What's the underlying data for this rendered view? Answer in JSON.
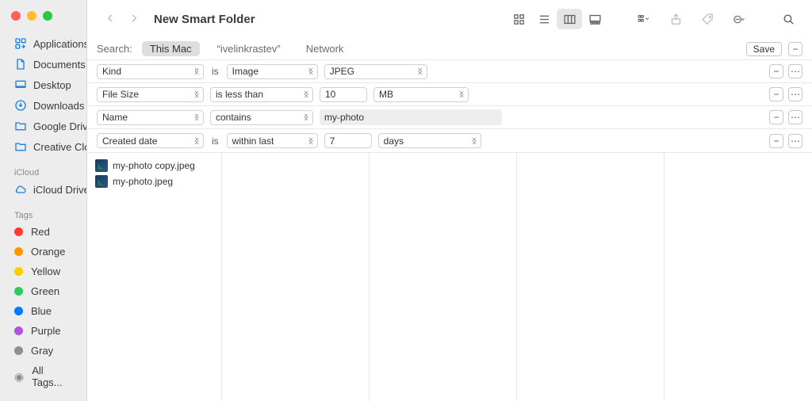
{
  "window": {
    "title": "New Smart Folder"
  },
  "sidebar": {
    "favorites": [
      {
        "label": "Applications",
        "icon": "apps"
      },
      {
        "label": "Documents",
        "icon": "doc"
      },
      {
        "label": "Desktop",
        "icon": "desktop"
      },
      {
        "label": "Downloads",
        "icon": "downloads"
      },
      {
        "label": "Google Drive",
        "icon": "folder"
      },
      {
        "label": "Creative Cloud Files...",
        "icon": "folder"
      }
    ],
    "icloud_header": "iCloud",
    "icloud": [
      {
        "label": "iCloud Drive",
        "icon": "cloud"
      }
    ],
    "tags_header": "Tags",
    "tags": [
      {
        "label": "Red",
        "color": "#ff3b30"
      },
      {
        "label": "Orange",
        "color": "#ff9500"
      },
      {
        "label": "Yellow",
        "color": "#ffcc00"
      },
      {
        "label": "Green",
        "color": "#34c759"
      },
      {
        "label": "Blue",
        "color": "#007aff"
      },
      {
        "label": "Purple",
        "color": "#af52de"
      },
      {
        "label": "Gray",
        "color": "#8e8e93"
      }
    ],
    "all_tags": "All Tags..."
  },
  "scope": {
    "label": "Search:",
    "options": [
      "This Mac",
      "“ivelinkrastev”",
      "Network"
    ],
    "selected": 0,
    "save": "Save"
  },
  "criteria": [
    {
      "attr": "Kind",
      "join": "is",
      "op": "Image",
      "extra_sel": "JPEG"
    },
    {
      "attr": "File Size",
      "op": "is less than",
      "value": "10",
      "unit": "MB"
    },
    {
      "attr": "Name",
      "op": "contains",
      "text": "my-photo"
    },
    {
      "attr": "Created date",
      "join": "is",
      "op": "within last",
      "value": "7",
      "unit": "days"
    }
  ],
  "results": {
    "files": [
      "my-photo copy.jpeg",
      "my-photo.jpeg"
    ]
  }
}
